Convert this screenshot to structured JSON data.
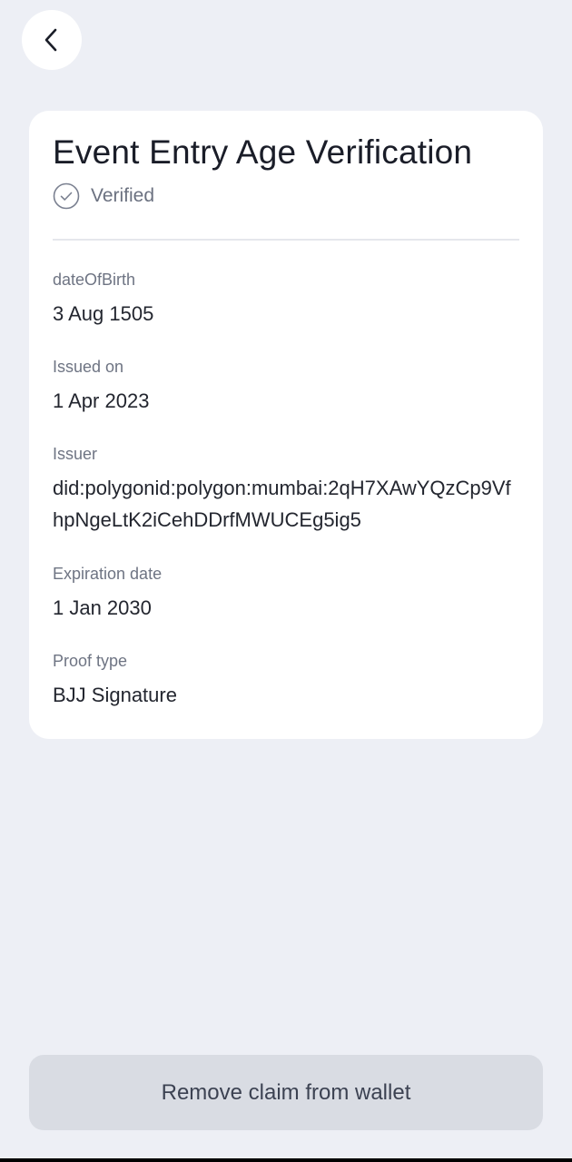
{
  "header": {
    "back_icon": "chevron-left-icon"
  },
  "card": {
    "title": "Event Entry Age Verification",
    "status": {
      "icon": "check-circle-icon",
      "label": "Verified"
    },
    "fields": [
      {
        "label": "dateOfBirth",
        "value": "3 Aug 1505"
      },
      {
        "label": "Issued on",
        "value": "1 Apr 2023"
      },
      {
        "label": "Issuer",
        "value": "did:polygonid:polygon:mumbai:2qH7XAwYQzCp9VfhpNgeLtK2iCehDDrfMWUCEg5ig5"
      },
      {
        "label": "Expiration date",
        "value": "1 Jan 2030"
      },
      {
        "label": "Proof type",
        "value": "BJJ Signature"
      }
    ]
  },
  "actions": {
    "remove_label": "Remove claim from wallet"
  },
  "colors": {
    "background": "#EDEFF5",
    "card": "#FFFFFF",
    "button": "#D9DCE3"
  }
}
